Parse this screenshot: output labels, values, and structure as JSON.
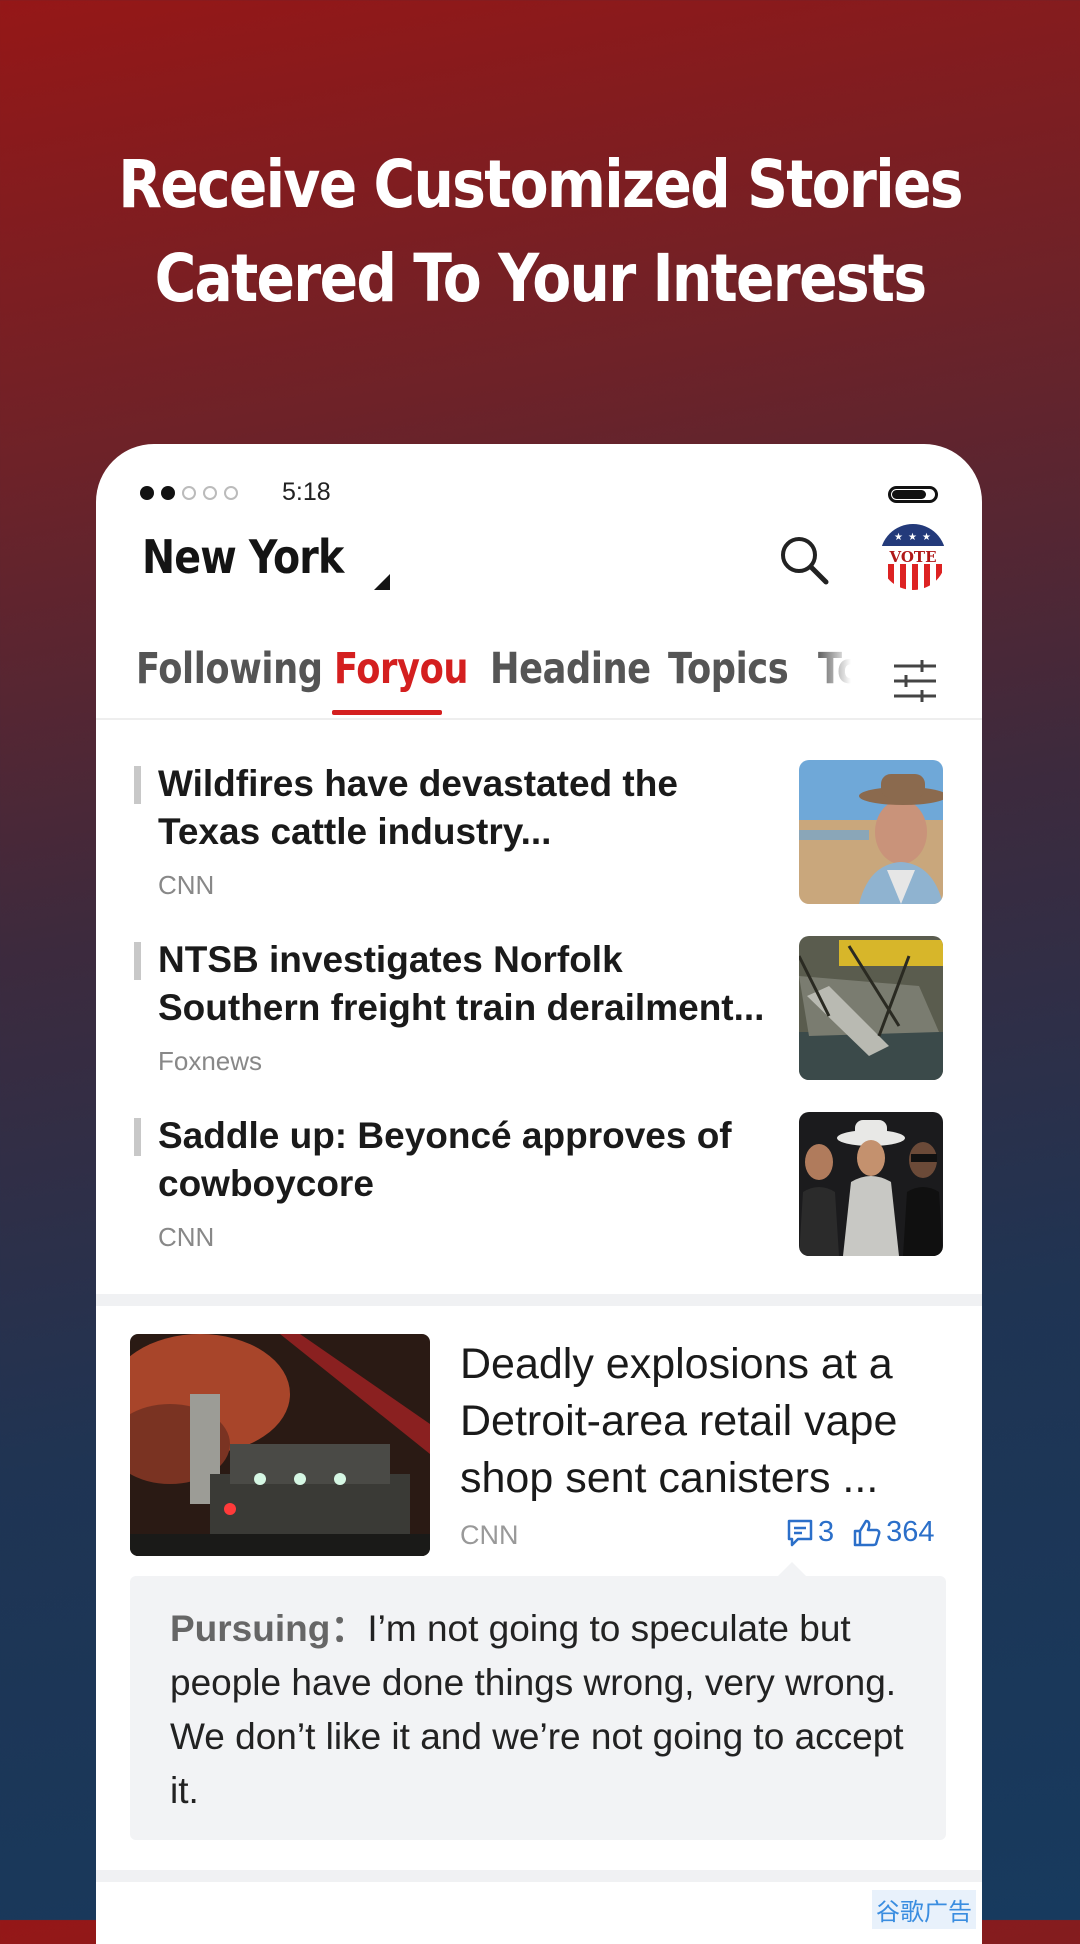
{
  "promo": {
    "line1": "Receive Customized Stories",
    "line2": "Catered To Your Interests"
  },
  "status_bar": {
    "time": "5:18",
    "signal_dots_filled": 2,
    "signal_dots_total": 5
  },
  "header": {
    "city": "New York",
    "vote_badge": "VOTE"
  },
  "tabs": [
    {
      "label": "Following",
      "active": false
    },
    {
      "label": "Foryou",
      "active": true
    },
    {
      "label": "Headine",
      "active": false
    },
    {
      "label": "Topics",
      "active": false
    },
    {
      "label": "Tc",
      "active": false
    }
  ],
  "news": [
    {
      "title": "Wildfires have devastated the Texas cattle industry...",
      "source": "CNN",
      "thumb": "cowboy-photo"
    },
    {
      "title": "NTSB investigates Norfolk Southern freight train derailment...",
      "source": "Foxnews",
      "thumb": "train-derailment-photo"
    },
    {
      "title": "Saddle up: Beyoncé approves of cowboycore",
      "source": "CNN",
      "thumb": "beyonce-photo"
    }
  ],
  "feature": {
    "title": "Deadly explosions at a Detroit-area retail vape shop sent canisters ...",
    "source": "CNN",
    "comments": "3",
    "likes": "364",
    "image": "fire-truck-night-photo",
    "quote_author": "Pursuing：",
    "quote_text": "I’m not going to speculate but people have done things wrong, very wrong. We don’t like it and we’re not going to accept it."
  },
  "ad_label": "谷歌广告",
  "colors": {
    "accent": "#d41f1f",
    "link": "#2b6fc9"
  }
}
